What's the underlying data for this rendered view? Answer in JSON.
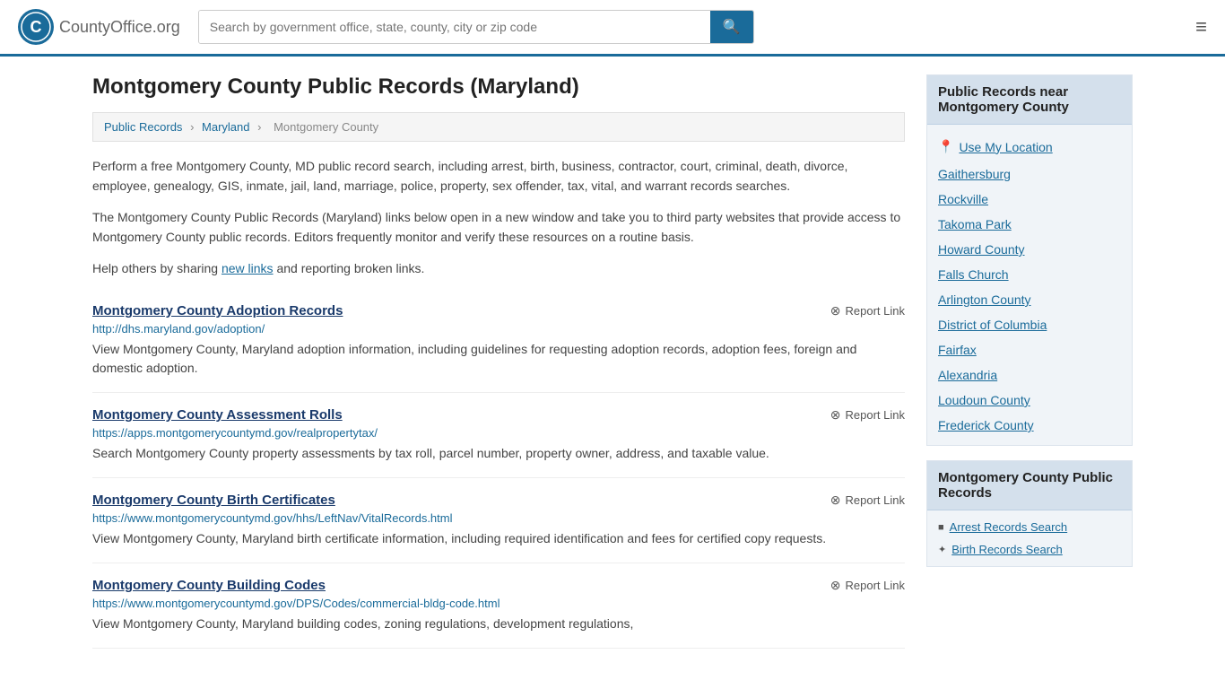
{
  "header": {
    "logo_text": "CountyOffice",
    "logo_suffix": ".org",
    "search_placeholder": "Search by government office, state, county, city or zip code",
    "search_button_icon": "🔍"
  },
  "page": {
    "title": "Montgomery County Public Records (Maryland)",
    "breadcrumb": {
      "items": [
        "Public Records",
        "Maryland",
        "Montgomery County"
      ]
    },
    "intro1": "Perform a free Montgomery County, MD public record search, including arrest, birth, business, contractor, court, criminal, death, divorce, employee, genealogy, GIS, inmate, jail, land, marriage, police, property, sex offender, tax, vital, and warrant records searches.",
    "intro2": "The Montgomery County Public Records (Maryland) links below open in a new window and take you to third party websites that provide access to Montgomery County public records. Editors frequently monitor and verify these resources on a routine basis.",
    "intro3_prefix": "Help others by sharing ",
    "intro3_link": "new links",
    "intro3_suffix": " and reporting broken links.",
    "records": [
      {
        "title": "Montgomery County Adoption Records",
        "url": "http://dhs.maryland.gov/adoption/",
        "desc": "View Montgomery County, Maryland adoption information, including guidelines for requesting adoption records, adoption fees, foreign and domestic adoption."
      },
      {
        "title": "Montgomery County Assessment Rolls",
        "url": "https://apps.montgomerycountymd.gov/realpropertytax/",
        "desc": "Search Montgomery County property assessments by tax roll, parcel number, property owner, address, and taxable value."
      },
      {
        "title": "Montgomery County Birth Certificates",
        "url": "https://www.montgomerycountymd.gov/hhs/LeftNav/VitalRecords.html",
        "desc": "View Montgomery County, Maryland birth certificate information, including required identification and fees for certified copy requests."
      },
      {
        "title": "Montgomery County Building Codes",
        "url": "https://www.montgomerycountymd.gov/DPS/Codes/commercial-bldg-code.html",
        "desc": "View Montgomery County, Maryland building codes, zoning regulations, development regulations,"
      }
    ],
    "report_link_label": "Report Link"
  },
  "sidebar": {
    "nearby_title": "Public Records near Montgomery County",
    "use_my_location": "Use My Location",
    "nearby_items": [
      "Gaithersburg",
      "Rockville",
      "Takoma Park",
      "Howard County",
      "Falls Church",
      "Arlington County",
      "District of Columbia",
      "Fairfax",
      "Alexandria",
      "Loudoun County",
      "Frederick County"
    ],
    "records_title": "Montgomery County Public Records",
    "records_items": [
      "Arrest Records Search",
      "Birth Records Search"
    ]
  }
}
